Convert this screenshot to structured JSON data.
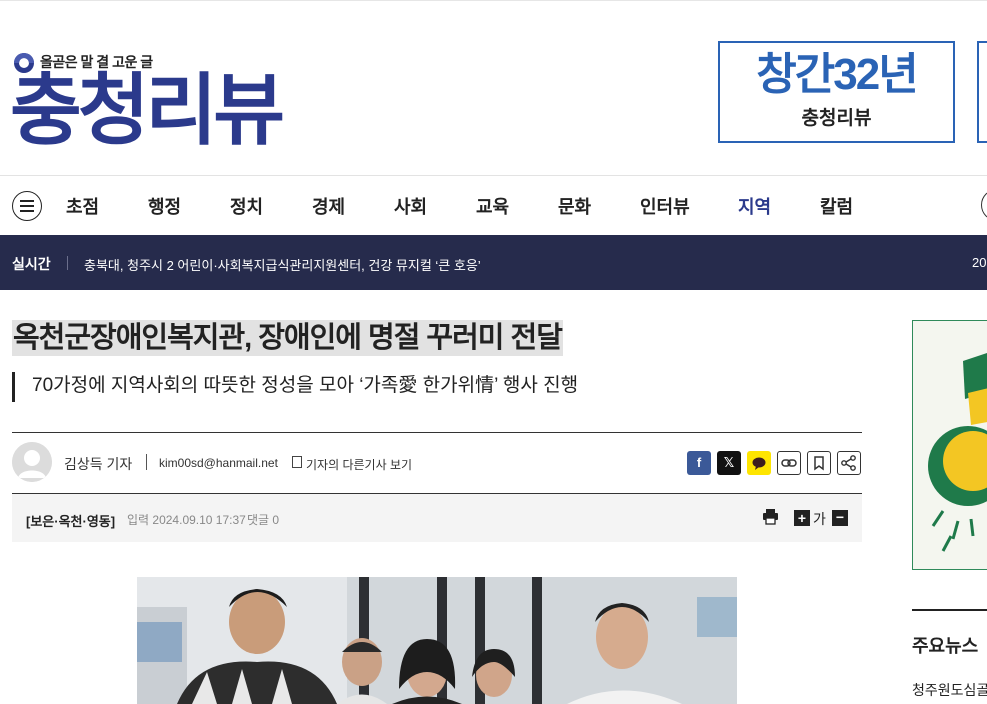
{
  "header": {
    "slogan": "올곧은 말 결 고운 글",
    "logo_text": "충청리뷰",
    "ad_main": "창간32년",
    "ad_sub": "충청리뷰"
  },
  "nav": {
    "items": [
      "초점",
      "행정",
      "정치",
      "경제",
      "사회",
      "교육",
      "문화",
      "인터뷰",
      "지역",
      "칼럼"
    ],
    "active": "지역"
  },
  "ticker": {
    "label": "실시간",
    "text": "충북대, 청주시 2 어린이·사회복지급식관리지원센터, 건강 뮤지컬 ‘큰 호응’",
    "date": "20"
  },
  "article": {
    "title": "옥천군장애인복지관, 장애인에 명절 꾸러미 전달",
    "subtitle": "70가정에 지역사회의 따뜻한 정성을 모아 ‘가족愛 한가위情’ 행사 진행",
    "reporter": "김상득 기자",
    "email": "kim00sd@hanmail.net",
    "more_articles": "기자의 다른기사 보기",
    "section": "[보은·옥천·영동]",
    "published": "입력 2024.09.10 17:37",
    "comments": "댓글 0",
    "font_label": "가"
  },
  "share": {
    "facebook": "f",
    "x": "𝕏"
  },
  "sidebar": {
    "title": "주요뉴스",
    "first_item": "청주원도심골"
  },
  "colors": {
    "brand": "#2b3a8c",
    "ticker_bg": "#262b4c",
    "ad_blue": "#2a63b5",
    "facebook": "#3b5998",
    "kakao": "#fee500"
  }
}
